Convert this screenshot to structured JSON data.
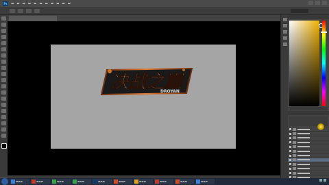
{
  "menu": {
    "ps_label": "Ps",
    "items": [
      "",
      "",
      "",
      "",
      "",
      "",
      "",
      "",
      "",
      "",
      ""
    ]
  },
  "logo_text": "决战之巅",
  "logo_sub": "DROYAN",
  "taskbar": {
    "clock": "",
    "date": ""
  },
  "colors": {
    "accent": "#f0b100",
    "canvas": "#a5a5a5",
    "doc_bg": "#000000",
    "panel": "#434343"
  }
}
